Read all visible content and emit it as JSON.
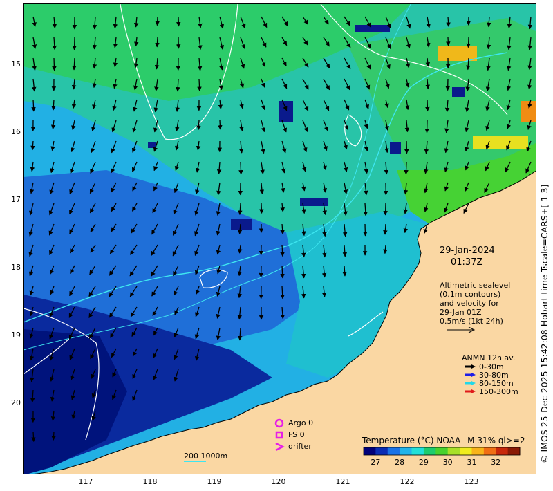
{
  "axes": {
    "lat_ticks": [
      "15",
      "16",
      "17",
      "18",
      "19",
      "20"
    ],
    "lat_values": [
      -15,
      -16,
      -17,
      -18,
      -19,
      -20
    ],
    "lon_ticks": [
      "117",
      "118",
      "119",
      "120",
      "121",
      "122",
      "123"
    ],
    "lon_values": [
      117,
      118,
      119,
      120,
      121,
      122,
      123
    ],
    "lon_range": [
      116,
      124
    ],
    "lat_range": [
      -14.1,
      -21.0
    ]
  },
  "timestamp": {
    "date": "29-Jan-2024",
    "time": "01:37Z"
  },
  "altimetry_note": [
    "Altimetric sealevel",
    "(0.1m contours)",
    "and velocity for",
    "29-Jan 01Z",
    "0.5m/s (1kt 24h)"
  ],
  "anmn_legend": {
    "title": "ANMN 12h av.",
    "items": [
      {
        "label": "0-30m",
        "color": "#000000"
      },
      {
        "label": "30-80m",
        "color": "#1e1ee6"
      },
      {
        "label": "80-150m",
        "color": "#22d8e8"
      },
      {
        "label": "150-300m",
        "color": "#e01a1a"
      }
    ]
  },
  "obs_legend": {
    "items": [
      {
        "label": "Argo 0",
        "symbol": "circle"
      },
      {
        "label": "FS 0",
        "symbol": "square"
      },
      {
        "label": "drifter",
        "symbol": "chevron"
      }
    ],
    "color": "#e61ee6"
  },
  "scale_note": "200  1000m",
  "colorbar": {
    "title": "Temperature (°C) NOAA _M 31% ql>=2",
    "ticks": [
      "27",
      "28",
      "29",
      "30",
      "31",
      "32"
    ],
    "tick_values": [
      27,
      28,
      29,
      30,
      31,
      32
    ],
    "range": [
      26.5,
      33.0
    ],
    "colors": [
      "#00007a",
      "#0a2cb4",
      "#1a73e8",
      "#22b4ea",
      "#22e0d8",
      "#1ecc6e",
      "#48d22e",
      "#a8e028",
      "#f0ec1e",
      "#f8b41a",
      "#f06e14",
      "#c8280a",
      "#8a1a04"
    ]
  },
  "side_caption": "© IMOS 25-Dec-2025 15:42:08 Hobart time Tscale=CARS+[-1 3]",
  "colors": {
    "land": "#fad7a3",
    "contour": "#ffffff",
    "isobath_200": "#3ee6f0",
    "arrow": "#000000"
  }
}
